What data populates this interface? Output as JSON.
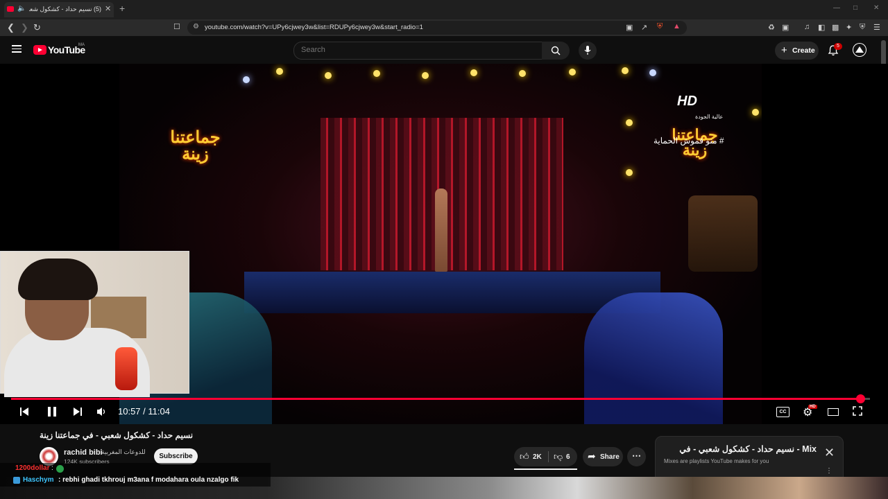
{
  "browser": {
    "tab_title": "(5) نسيم حداد - كشكول شعبي",
    "url": "youtube.com/watch?v=UPy6cjwey3w&list=RDUPy6cjwey3w&start_radio=1"
  },
  "header": {
    "logo_text": "YouTube",
    "country_code": "MA",
    "search_placeholder": "Search",
    "create_label": "Create",
    "notification_count": "5"
  },
  "player": {
    "current_time": "10:57",
    "duration": "11:04",
    "time_display": "10:57 / 11:04",
    "progress_fraction": 0.989,
    "settings_badge": "HD",
    "cc_label": "CC"
  },
  "video_overlay": {
    "broadcaster": "HD",
    "broadcaster_sub": "عالية الجودة",
    "hashtag": "# منو قموش الحماية",
    "show_logo": "جماعتنا زينة"
  },
  "video": {
    "title": "نسيم حداد - كشكول شعبي - في جماعتنا زينة",
    "channel_name": "rachid bibi",
    "channel_tag": "للدوعات المغربية",
    "subscribers": "124K subscribers",
    "subscribe_label": "Subscribe",
    "likes": "2K",
    "dislikes": "6",
    "share_label": "Share"
  },
  "mix": {
    "title": "Mix - نسيم حداد - كشكول شعبي - في",
    "subtitle": "Mixes are playlists YouTube makes for you"
  },
  "chat": {
    "user1": "1200dollar",
    "user2": "Haschym",
    "message": ": rebhi ghadi tkhrouj m3ana f modahara oula nzalgo fik"
  },
  "colors": {
    "accent": "#ff0033",
    "background": "#0f0f0f"
  }
}
